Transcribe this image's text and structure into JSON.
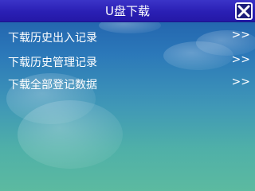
{
  "window": {
    "title": "U盘下载",
    "close_icon": "close-x-icon"
  },
  "menu": {
    "items": [
      {
        "label": "下载历史出入记录",
        "arrow": ">>"
      },
      {
        "label": "下载历史管理记录",
        "arrow": ">>"
      },
      {
        "label": "下载全部登记数据",
        "arrow": ">>"
      }
    ]
  },
  "colors": {
    "titlebar": "#2a1fb4",
    "background_top": "#1f5aa8",
    "background_bottom": "#5cbaa0",
    "text": "#ffffff"
  }
}
